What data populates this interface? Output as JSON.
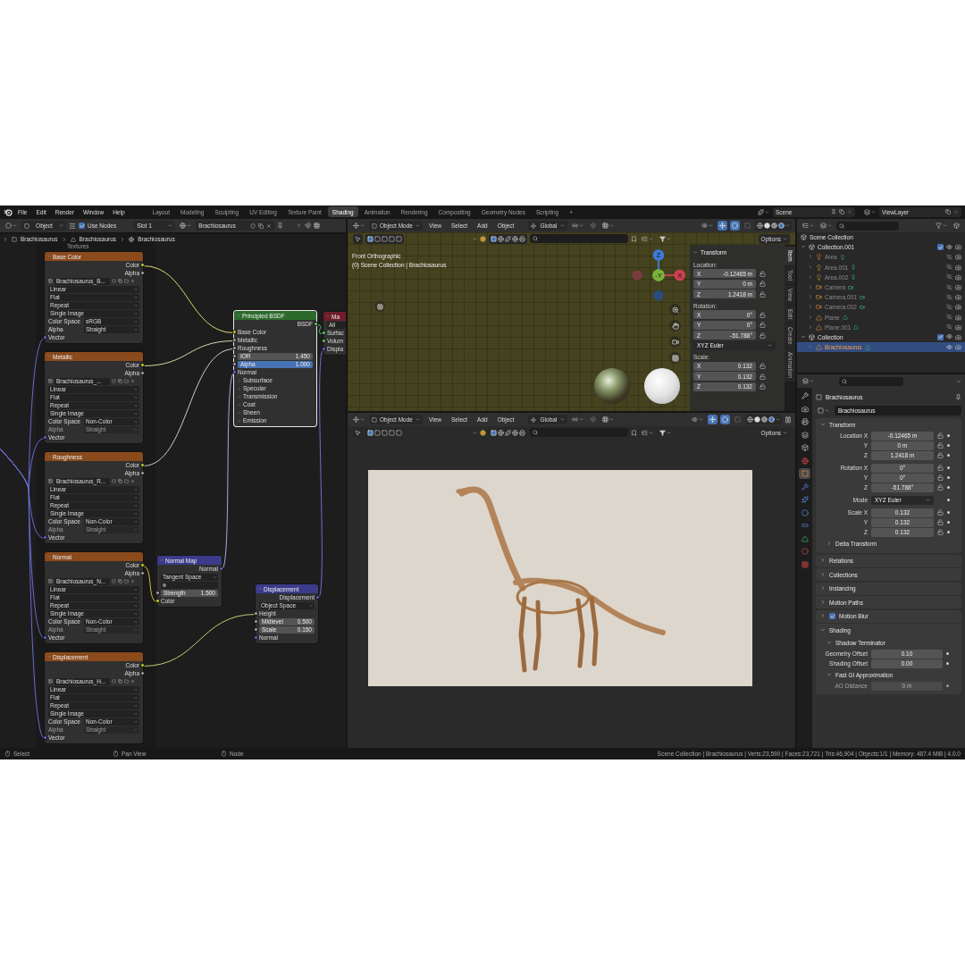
{
  "topbar": {
    "menus": [
      "File",
      "Edit",
      "Render",
      "Window",
      "Help"
    ],
    "workspaces": [
      {
        "label": "Layout",
        "selected": false
      },
      {
        "label": "Modeling",
        "selected": false
      },
      {
        "label": "Sculpting",
        "selected": false
      },
      {
        "label": "UV Editing",
        "selected": false
      },
      {
        "label": "Texture Paint",
        "selected": false
      },
      {
        "label": "Shading",
        "selected": true
      },
      {
        "label": "Animation",
        "selected": false
      },
      {
        "label": "Rendering",
        "selected": false
      },
      {
        "label": "Compositing",
        "selected": false
      },
      {
        "label": "Geometry Nodes",
        "selected": false
      },
      {
        "label": "Scripting",
        "selected": false
      }
    ],
    "add_workspace": "+",
    "scene": "Scene",
    "view_layer": "ViewLayer"
  },
  "node_editor": {
    "header": {
      "object_type": "Object",
      "use_nodes": {
        "label": "Use Nodes",
        "checked": true
      },
      "slot": "Slot 1",
      "material": "Brachiosaurus"
    },
    "breadcrumbs": [
      "Brachiosaurus",
      "Brachiosaurus",
      "Brachiosaurus"
    ],
    "frame_label": "Textures",
    "image_nodes": [
      {
        "title": "Base Color",
        "outputs": [
          "Color",
          "Alpha"
        ],
        "image": "Brachiosaurus_B...",
        "interpolation": "Linear",
        "projection": "Flat",
        "extension": "Repeat",
        "source": "Single Image",
        "color_space_label": "Color Space",
        "color_space": "sRGB",
        "alpha_label": "Alpha",
        "alpha_mode": "Straight",
        "alpha_enabled": true,
        "input": "Vector"
      },
      {
        "title": "Metallic",
        "outputs": [
          "Color",
          "Alpha"
        ],
        "image": "Brachiosaurus_...",
        "interpolation": "Linear",
        "projection": "Flat",
        "extension": "Repeat",
        "source": "Single Image",
        "color_space_label": "Color Space",
        "color_space": "Non-Color",
        "alpha_label": "Alpha",
        "alpha_mode": "Straight",
        "alpha_enabled": false,
        "input": "Vector"
      },
      {
        "title": "Roughness",
        "outputs": [
          "Color",
          "Alpha"
        ],
        "image": "Brachiosaurus_R...",
        "interpolation": "Linear",
        "projection": "Flat",
        "extension": "Repeat",
        "source": "Single Image",
        "color_space_label": "Color Space",
        "color_space": "Non-Color",
        "alpha_label": "Alpha",
        "alpha_mode": "Straight",
        "alpha_enabled": false,
        "input": "Vector"
      },
      {
        "title": "Normal",
        "outputs": [
          "Color",
          "Alpha"
        ],
        "image": "Brachiosaurus_N...",
        "interpolation": "Linear",
        "projection": "Flat",
        "extension": "Repeat",
        "source": "Single Image",
        "color_space_label": "Color Space",
        "color_space": "Non-Color",
        "alpha_label": "Alpha",
        "alpha_mode": "Straight",
        "alpha_enabled": false,
        "input": "Vector"
      },
      {
        "title": "Displacement",
        "outputs": [
          "Color",
          "Alpha"
        ],
        "image": "Brachiosaurus_H...",
        "interpolation": "Linear",
        "projection": "Flat",
        "extension": "Repeat",
        "source": "Single Image",
        "color_space_label": "Color Space",
        "color_space": "Non-Color",
        "alpha_label": "Alpha",
        "alpha_mode": "Straight",
        "alpha_enabled": false,
        "input": "Vector"
      }
    ],
    "principled": {
      "title": "Principled BSDF",
      "active": true,
      "output": "BSDF",
      "inputs": [
        "Base Color",
        "Metallic",
        "Roughness"
      ],
      "fields": [
        {
          "label": "IOR",
          "value": "1.450",
          "selected": false
        },
        {
          "label": "Alpha",
          "value": "1.000",
          "selected": true
        }
      ],
      "normal": "Normal",
      "panels": [
        "Subsurface",
        "Specular",
        "Transmission",
        "Coat",
        "Sheen",
        "Emission"
      ]
    },
    "material_output": {
      "title": "Ma",
      "target": "All",
      "inputs": [
        "Surfac",
        "Volum",
        "Displa"
      ]
    },
    "normal_map": {
      "title": "Normal Map",
      "output": "Normal",
      "space": "Tangent Space",
      "strength_label": "Strength",
      "strength": "1.500",
      "input": "Color"
    },
    "displacement": {
      "title": "Displacement",
      "output": "Displacement",
      "space": "Object Space",
      "input": "Height",
      "fields": [
        {
          "label": "Midlevel",
          "value": "0.500"
        },
        {
          "label": "Scale",
          "value": "0.150"
        }
      ],
      "normal": "Normal"
    }
  },
  "viewports": [
    {
      "kind": "ortho",
      "mode": "Object Mode",
      "menus": [
        "View",
        "Select",
        "Add",
        "Object"
      ],
      "orientation": "Global",
      "options": "Options",
      "view_name": "Front Orthographic",
      "view_info": "(0) Scene Collection | Brachiosaurus",
      "gizmo": [
        "Z",
        "-Y",
        "X"
      ]
    },
    {
      "kind": "camera",
      "mode": "Object Mode",
      "menus": [
        "View",
        "Select",
        "Add",
        "Object"
      ],
      "orientation": "Global",
      "options": "Options"
    }
  ],
  "n_panel": {
    "title": "Transform",
    "groups": [
      {
        "label": "Location:",
        "rows": [
          {
            "axis": "X",
            "value": "-0.12465 m"
          },
          {
            "axis": "Y",
            "value": "0 m"
          },
          {
            "axis": "Z",
            "value": "1.2418 m"
          }
        ]
      },
      {
        "label": "Rotation:",
        "rows": [
          {
            "axis": "X",
            "value": "0°"
          },
          {
            "axis": "Y",
            "value": "0°"
          },
          {
            "axis": "Z",
            "value": "-51.788°"
          }
        ],
        "mode": "XYZ Euler"
      },
      {
        "label": "Scale:",
        "rows": [
          {
            "axis": "X",
            "value": "0.132"
          },
          {
            "axis": "Y",
            "value": "0.132"
          },
          {
            "axis": "Z",
            "value": "0.132"
          }
        ]
      }
    ],
    "tabs": [
      {
        "label": "Item",
        "selected": true
      },
      {
        "label": "Tool",
        "selected": false
      },
      {
        "label": "View",
        "selected": false
      },
      {
        "label": "Edit",
        "selected": false
      },
      {
        "label": "Create",
        "selected": false
      },
      {
        "label": "Animation",
        "selected": false
      }
    ]
  },
  "outliner": {
    "root": "Scene Collection",
    "collections": [
      {
        "name": "Collection.001",
        "kind": "collection",
        "expanded": true,
        "checked": true,
        "visible": true,
        "selected": false,
        "children": [
          {
            "name": "Area",
            "kind": "light",
            "expanded": false,
            "visible": false,
            "selected": false
          },
          {
            "name": "Area.001",
            "kind": "light",
            "expanded": false,
            "visible": false,
            "selected": false
          },
          {
            "name": "Area.002",
            "kind": "light",
            "expanded": false,
            "visible": false,
            "selected": false
          },
          {
            "name": "Camera",
            "kind": "camera",
            "expanded": false,
            "visible": false,
            "selected": false
          },
          {
            "name": "Camera.001",
            "kind": "camera",
            "expanded": false,
            "visible": false,
            "selected": false
          },
          {
            "name": "Camera.002",
            "kind": "camera",
            "expanded": false,
            "visible": false,
            "selected": false
          },
          {
            "name": "Plane",
            "kind": "mesh",
            "expanded": false,
            "visible": false,
            "selected": false
          },
          {
            "name": "Plane.001",
            "kind": "mesh",
            "expanded": false,
            "visible": false,
            "selected": false
          }
        ]
      },
      {
        "name": "Collection",
        "kind": "collection",
        "expanded": true,
        "checked": true,
        "visible": true,
        "selected": false,
        "children": [
          {
            "name": "Brachiosaurus",
            "kind": "mesh",
            "expanded": false,
            "visible": true,
            "selected": true
          }
        ]
      }
    ]
  },
  "properties": {
    "tabs": [
      {
        "kind": "tool",
        "selected": false
      },
      {
        "kind": "render",
        "selected": false
      },
      {
        "kind": "output",
        "selected": false
      },
      {
        "kind": "view_layer",
        "selected": false
      },
      {
        "kind": "scene",
        "selected": false
      },
      {
        "kind": "world",
        "selected": false
      },
      {
        "kind": "object",
        "selected": true
      },
      {
        "kind": "modifiers",
        "selected": false
      },
      {
        "kind": "particles",
        "selected": false
      },
      {
        "kind": "physics",
        "selected": false
      },
      {
        "kind": "constraints",
        "selected": false
      },
      {
        "kind": "data",
        "selected": false
      },
      {
        "kind": "material",
        "selected": false
      },
      {
        "kind": "texture",
        "selected": false
      }
    ],
    "object_title": "Brachiosaurus",
    "object_name": "Brachiosaurus",
    "transform": {
      "title": "Transform",
      "expanded": true,
      "groups": [
        {
          "rows": [
            {
              "label": "Location X",
              "value": "-0.12465 m",
              "kind": "number"
            },
            {
              "label": "Y",
              "value": "0 m",
              "kind": "number"
            },
            {
              "label": "Z",
              "value": "1.2418 m",
              "kind": "number"
            }
          ]
        },
        {
          "rows": [
            {
              "label": "Rotation X",
              "value": "0°",
              "kind": "number"
            },
            {
              "label": "Y",
              "value": "0°",
              "kind": "number"
            },
            {
              "label": "Z",
              "value": "-51.788°",
              "kind": "number"
            }
          ]
        },
        {
          "rows": [
            {
              "label": "Mode",
              "value": "XYZ Euler",
              "kind": "dropdown"
            }
          ]
        },
        {
          "rows": [
            {
              "label": "Scale X",
              "value": "0.132",
              "kind": "number"
            },
            {
              "label": "Y",
              "value": "0.132",
              "kind": "number"
            },
            {
              "label": "Z",
              "value": "0.132",
              "kind": "number"
            }
          ]
        }
      ],
      "subpanel": {
        "title": "Delta Transform",
        "expanded": false
      }
    },
    "panels": [
      {
        "title": "Relations",
        "expanded": false,
        "kind": "plain"
      },
      {
        "title": "Collections",
        "expanded": false,
        "kind": "plain"
      },
      {
        "title": "Instancing",
        "expanded": false,
        "kind": "plain"
      },
      {
        "title": "Motion Paths",
        "expanded": false,
        "kind": "plain"
      },
      {
        "title": "Motion Blur",
        "expanded": false,
        "kind": "toggle",
        "checked": true
      }
    ],
    "shading": {
      "title": "Shading",
      "expanded": true,
      "subpanels": [
        {
          "title": "Shadow Terminator",
          "expanded": true,
          "rows": [
            {
              "label": "Geometry Offset",
              "value": "0.10",
              "disabled": false
            },
            {
              "label": "Shading Offset",
              "value": "0.00",
              "disabled": false
            }
          ]
        },
        {
          "title": "Fast GI Approximation",
          "expanded": true,
          "rows": [
            {
              "label": "AO Distance",
              "value": "0 m",
              "disabled": true
            }
          ]
        }
      ]
    }
  },
  "status_bar": {
    "hints": [
      "Select",
      "Pan View",
      "Node"
    ],
    "info": "Scene Collection | Brachiosaurus | Verts:23,590 | Faces:23,721 | Tris:46,904 | Objects:1/1 | Memory: 487.4 MiB | 4.0.0"
  }
}
